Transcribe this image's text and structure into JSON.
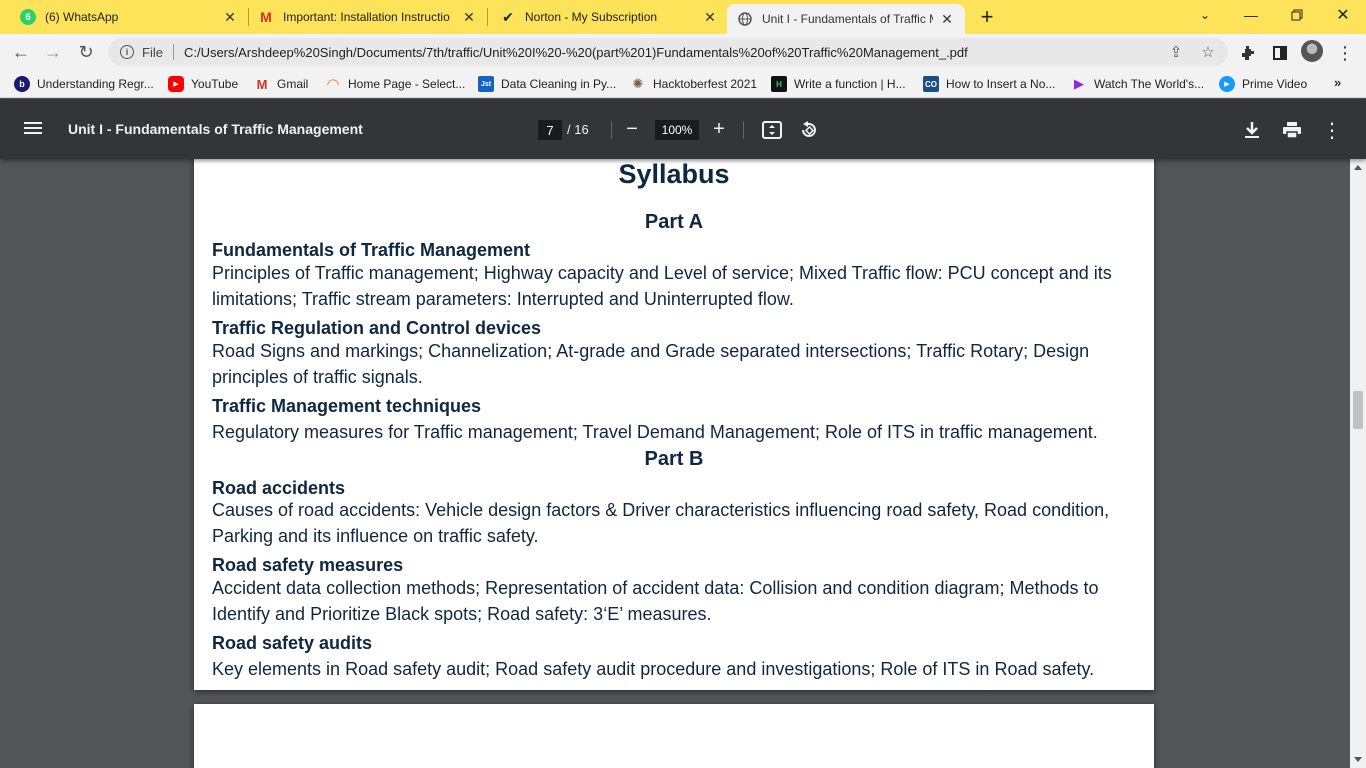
{
  "browser": {
    "tabs": [
      {
        "title": "(6) WhatsApp",
        "icon": "whatsapp-icon",
        "badge": "6"
      },
      {
        "title": "Important: Installation Instructio",
        "icon": "gmail-icon"
      },
      {
        "title": "Norton - My Subscription",
        "icon": "checkmark-icon"
      },
      {
        "title": "Unit I - Fundamentals of Traffic M",
        "icon": "globe-icon"
      }
    ],
    "address": {
      "scheme": "File",
      "url": "C:/Users/Arshdeep%20Singh/Documents/7th/traffic/Unit%20I%20-%20(part%201)Fundamentals%20of%20Traffic%20Management_.pdf"
    },
    "bookmarks": [
      {
        "label": "Understanding Regr...",
        "icon": "b-icon",
        "color": "#1a1a6e"
      },
      {
        "label": "YouTube",
        "icon": "youtube-icon",
        "color": "#ff0000"
      },
      {
        "label": "Gmail",
        "icon": "gmail-icon",
        "color": "#d93025"
      },
      {
        "label": "Home Page - Select...",
        "icon": "arc-icon",
        "color": "#f07a1a"
      },
      {
        "label": "Data Cleaning in Py...",
        "icon": "justdata-icon",
        "color": "#1565c0"
      },
      {
        "label": "Hacktoberfest 2021",
        "icon": "hacktoberfest-icon",
        "color": "#7a5c3a"
      },
      {
        "label": "Write a function | H...",
        "icon": "hackerrank-icon",
        "color": "#111111"
      },
      {
        "label": "How to Insert a No...",
        "icon": "co-icon",
        "color": "#1b4f8a"
      },
      {
        "label": "Watch The World's...",
        "icon": "play-icon",
        "color": "#8a2be2"
      },
      {
        "label": "Prime Video",
        "icon": "prime-video-icon",
        "color": "#1a98ff"
      }
    ]
  },
  "pdf": {
    "title": "Unit I - Fundamentals of Traffic Management",
    "current_page": "7",
    "total_pages": "/ 16",
    "zoom": "100%"
  },
  "document": {
    "heading": "Syllabus",
    "part_a": "Part A",
    "part_b": "Part B",
    "sections": [
      {
        "title": "Fundamentals of Traffic Management",
        "body": "Principles of Traffic management; Highway capacity and Level of service; Mixed Traffic flow: PCU concept and its limitations; Traffic stream parameters: Interrupted and Uninterrupted flow."
      },
      {
        "title": "Traffic Regulation and Control devices",
        "body": "Road Signs and markings; Channelization; At-grade and Grade separated intersections; Traffic Rotary; Design principles of traffic signals."
      },
      {
        "title": "Traffic Management techniques",
        "body": "Regulatory measures for Traffic management; Travel Demand Management; Role of ITS in traffic management."
      },
      {
        "title": "Road accidents",
        "body": "Causes of road accidents: Vehicle design factors & Driver characteristics influencing road safety, Road condition, Parking and its influence on traffic safety."
      },
      {
        "title": "Road safety measures",
        "body": "Accident data collection methods; Representation of accident data: Collision and condition diagram; Methods to Identify and Prioritize Black spots; Road safety: 3‘E’ measures."
      },
      {
        "title": "Road safety audits",
        "body": "Key elements in Road safety audit; Road safety audit procedure and investigations; Role of ITS in Road safety."
      }
    ]
  },
  "colors": {
    "tabstrip": "#fce359",
    "pdf_toolbar": "#323639",
    "viewer_bg": "#525659",
    "heading_text": "#0e2841"
  }
}
